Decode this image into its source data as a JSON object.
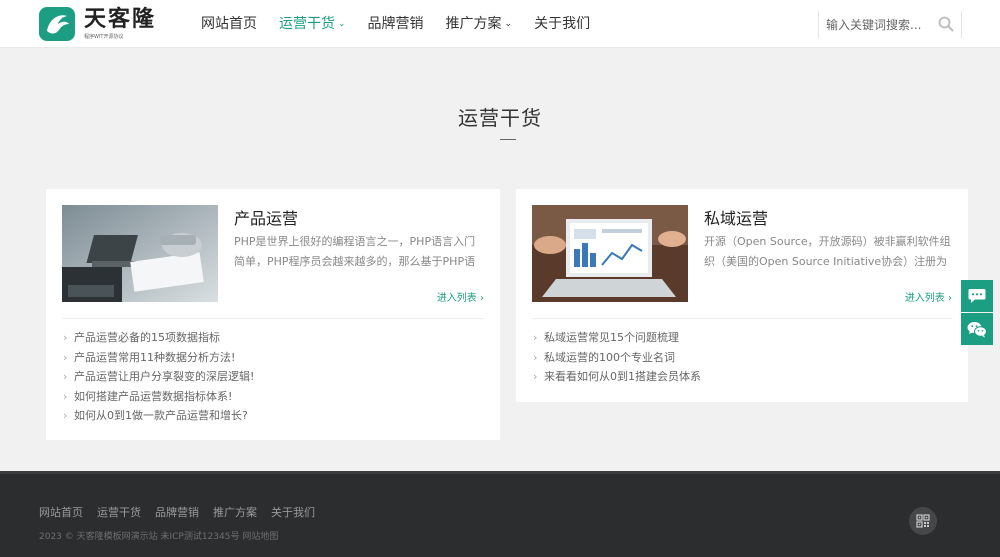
{
  "header": {
    "logo_title": "天客隆",
    "logo_sub": "程序WIT开源协议",
    "nav": [
      {
        "label": "网站首页",
        "caret": false,
        "active": false
      },
      {
        "label": "运营干货",
        "caret": true,
        "active": true
      },
      {
        "label": "品牌营销",
        "caret": false,
        "active": false
      },
      {
        "label": "推广方案",
        "caret": true,
        "active": false
      },
      {
        "label": "关于我们",
        "caret": false,
        "active": false
      }
    ],
    "search_placeholder": "输入关键词搜索..."
  },
  "section": {
    "title": "运营干货"
  },
  "cards": [
    {
      "name": "产品运营",
      "desc": "PHP是世界上很好的编程语言之一，PHP语言入门简单，PHP程序员会越来越多的，那么基于PHP语言...",
      "more": "进入列表",
      "items": [
        "产品运营必备的15项数据指标",
        "产品运营常用11种数据分析方法!",
        "产品运营让用户分享裂变的深层逻辑!",
        "如何搭建产品运营数据指标体系!",
        "如何从0到1做一款产品运营和增长?"
      ]
    },
    {
      "name": "私域运营",
      "desc": "开源（Open Source，开放源码）被非赢利软件组织（美国的Open Source Initiative协会）注册为认证...",
      "more": "进入列表",
      "items": [
        "私域运营常见15个问题梳理",
        "私域运营的100个专业名词",
        "来看看如何从0到1搭建会员体系"
      ]
    }
  ],
  "footer": {
    "links": [
      "网站首页",
      "运营干货",
      "品牌营销",
      "推广方案",
      "关于我们"
    ],
    "copyright": "2023 © 天客隆模板网演示站 未ICP测试12345号 网站地图"
  },
  "colors": {
    "accent": "#1b9e82",
    "footer_bg": "#2b2d2f"
  },
  "icons": {
    "search": "search-icon",
    "chat": "chat-bubble-icon",
    "wechat": "wechat-icon",
    "qr": "qrcode-icon",
    "chevron": "chevron-right-icon"
  }
}
